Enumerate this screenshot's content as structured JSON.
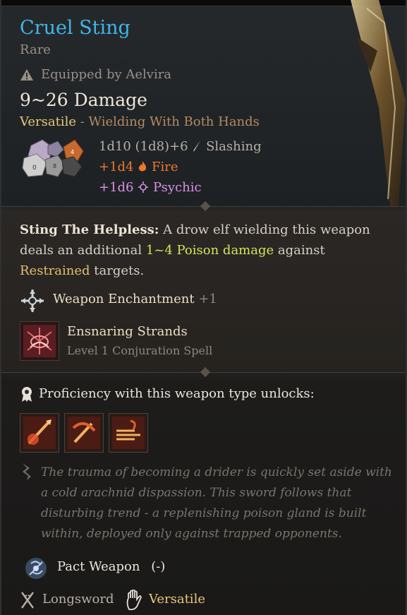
{
  "item": {
    "name": "Cruel Sting",
    "rarity": "Rare",
    "equipped_by": "Equipped by Aelvira",
    "damage_total": "9~26 Damage",
    "versatile": "Versatile",
    "versatile_sep": "-",
    "wielding": "Wielding With Both Hands"
  },
  "damage_rows": [
    {
      "dice": "1d10 (1d8)+6",
      "type": "Slashing",
      "icon": "slashing-icon",
      "color": "#b8b0a8"
    },
    {
      "dice": "+1d4",
      "type": "Fire",
      "icon": "fire-icon",
      "color": "#f0782a"
    },
    {
      "dice": "+1d6",
      "type": "Psychic",
      "icon": "psychic-icon",
      "color": "#dc8fe6"
    }
  ],
  "passive": {
    "name": "Sting The Helpless:",
    "text_1": "A drow elf wielding this weapon deals an additional",
    "highlight": "1~4 Poison damage",
    "text_2": "against",
    "condition": "Restrained",
    "text_3": "targets."
  },
  "enchantment": {
    "label": "Weapon Enchantment",
    "bonus": "+1",
    "icon": "enchantment-icon"
  },
  "spell": {
    "name": "Ensnaring Strands",
    "subtitle": "Level 1 Conjuration Spell",
    "icon": "web-spell-icon"
  },
  "proficiency": {
    "label": "Proficiency with this weapon type unlocks:",
    "actions": [
      {
        "icon": "action-1-icon"
      },
      {
        "icon": "action-2-icon"
      },
      {
        "icon": "action-3-icon"
      }
    ]
  },
  "lore": "The trauma of becoming a drider is quickly set aside with a cold arachnid dispassion. This sword follows that disturbing trend - a replenishing poison gland is built within, deployed only against trapped opponents.",
  "pact": {
    "label": "Pact Weapon",
    "value": "(-)"
  },
  "footer": {
    "weapon_type": "Longsword",
    "property": "Versatile"
  },
  "colors": {
    "title": "#3fb6ec",
    "gold": "#e9c87a",
    "poison": "#d6e45a"
  }
}
